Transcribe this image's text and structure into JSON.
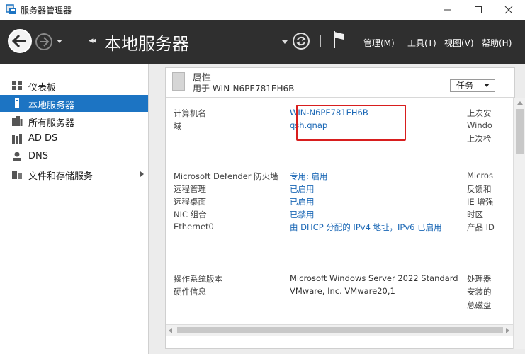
{
  "window": {
    "title": "服务器管理器"
  },
  "header": {
    "breadcrumb": "本地服务器",
    "menus": [
      {
        "label": "管理(M)"
      },
      {
        "label": "工具(T)"
      },
      {
        "label": "视图(V)"
      },
      {
        "label": "帮助(H)"
      }
    ]
  },
  "sidebar": {
    "items": [
      {
        "label": "仪表板",
        "icon": "dashboard-icon"
      },
      {
        "label": "本地服务器",
        "icon": "local-server-icon",
        "active": true
      },
      {
        "label": "所有服务器",
        "icon": "all-servers-icon"
      },
      {
        "label": "AD DS",
        "icon": "ad-ds-icon"
      },
      {
        "label": "DNS",
        "icon": "dns-icon"
      },
      {
        "label": "文件和存储服务",
        "icon": "file-storage-icon",
        "expandable": true
      }
    ]
  },
  "properties": {
    "title": "属性",
    "subtitle": "用于 WIN-N6PE781EH6B",
    "tasks_label": "任务",
    "rows": [
      {
        "key": "计算机名",
        "value": "WIN-N6PE781EH6B",
        "link": true,
        "col3": "上次安"
      },
      {
        "key": "域",
        "value": "qsh.qnap",
        "link": true,
        "col3": "Windo"
      },
      {
        "key": "",
        "value": "",
        "link": false,
        "col3": "上次检"
      },
      {
        "key": "Microsoft Defender 防火墙",
        "value": "专用: 启用",
        "link": true,
        "col3": "Micros"
      },
      {
        "key": "远程管理",
        "value": "已启用",
        "link": true,
        "col3": "反馈和"
      },
      {
        "key": "远程桌面",
        "value": "已启用",
        "link": true,
        "col3": "IE 增强"
      },
      {
        "key": "NIC 组合",
        "value": "已禁用",
        "link": true,
        "col3": "时区"
      },
      {
        "key": "Ethernet0",
        "value": "由 DHCP 分配的 IPv4 地址，IPv6 已启用",
        "link": true,
        "col3": "产品 ID"
      },
      {
        "key": "操作系统版本",
        "value": "Microsoft Windows Server 2022 Standard",
        "link": false,
        "col3": "处理器"
      },
      {
        "key": "硬件信息",
        "value": "VMware, Inc. VMware20,1",
        "link": false,
        "col3": "安装的"
      },
      {
        "key": "",
        "value": "",
        "link": false,
        "col3": "总磁盘"
      }
    ]
  },
  "colors": {
    "header_bg": "#2f2f2f",
    "accent": "#1c74c3",
    "link": "#1a67b5",
    "highlight": "#d81e1e"
  }
}
